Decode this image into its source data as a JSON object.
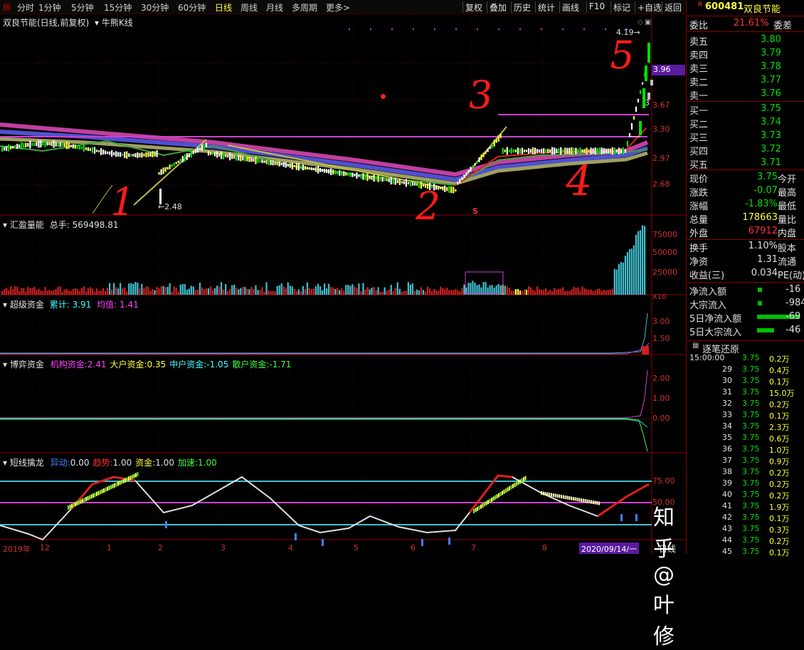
{
  "toolbar": {
    "periods": [
      "分时",
      "1分钟",
      "5分钟",
      "15分钟",
      "30分钟",
      "60分钟",
      "日线",
      "周线",
      "月线",
      "多周期",
      "更多>"
    ],
    "active_period": "日线",
    "right_buttons": [
      "复权",
      "叠加",
      "历史",
      "统计",
      "画线",
      "F10",
      "标记",
      "+自选",
      "返回"
    ]
  },
  "kline": {
    "title": "双良节能(日线,前复权)",
    "indicator": "牛熊K线",
    "price_labels": [
      "3.96",
      "3.67",
      "3.30",
      "2.97",
      "2.68"
    ],
    "low_label": "2.48",
    "high_label": "4.19",
    "small_label": "3",
    "marker_s": "S"
  },
  "volume": {
    "title": "汇盈量能",
    "total_label": "总手:",
    "total_value": "569498.81",
    "axis": [
      "75000",
      "50000",
      "25000"
    ],
    "unit": "X10"
  },
  "super_funds": {
    "title": "超级资金",
    "accum_label": "累计:",
    "accum_value": "3.91",
    "avg_label": "均值:",
    "avg_value": "1.41",
    "axis": [
      "3.00",
      "1.50"
    ]
  },
  "game_funds": {
    "title": "博弈资金",
    "items": [
      {
        "label": "机构资金:",
        "value": "2.41",
        "color": "#ff40ff"
      },
      {
        "label": "大户资金:",
        "value": "0.35",
        "color": "#ffff40"
      },
      {
        "label": "中户资金:",
        "value": "-1.05",
        "color": "#40ffff"
      },
      {
        "label": "散户资金:",
        "value": "-1.71",
        "color": "#40ff40"
      }
    ],
    "axis": [
      "2.00",
      "1.00",
      "0.00"
    ]
  },
  "short_line": {
    "title": "短线擒龙",
    "items": [
      {
        "label": "异动:",
        "value": "0.00",
        "color": "#4080ff"
      },
      {
        "label": "趋势:",
        "value": "1.00",
        "color": "#ff3030"
      },
      {
        "label": "资金:",
        "value": "1.00",
        "color": "#ffff40"
      },
      {
        "label": "加速:",
        "value": "1.00",
        "color": "#40ff40"
      }
    ],
    "axis": [
      "75.00",
      "50.00"
    ]
  },
  "xaxis": {
    "labels": [
      "2019年",
      "12",
      "1",
      "2",
      "3",
      "4",
      "5",
      "6",
      "7",
      "8"
    ],
    "date_badge": "2020/09/14/一",
    "period": "日线"
  },
  "annotations": [
    "1",
    "2",
    "3",
    "4",
    "5"
  ],
  "watermark": "知乎 @叶修",
  "quote": {
    "code": "600481",
    "name": "双良节能",
    "webi_label": "委比",
    "webi_value": "21.61%",
    "weicha_label": "委差",
    "sell": [
      {
        "label": "卖五",
        "price": "3.80"
      },
      {
        "label": "卖四",
        "price": "3.79"
      },
      {
        "label": "卖三",
        "price": "3.78"
      },
      {
        "label": "卖二",
        "price": "3.77"
      },
      {
        "label": "卖一",
        "price": "3.76"
      }
    ],
    "buy": [
      {
        "label": "买一",
        "price": "3.75"
      },
      {
        "label": "买二",
        "price": "3.74"
      },
      {
        "label": "买三",
        "price": "3.73"
      },
      {
        "label": "买四",
        "price": "3.72"
      },
      {
        "label": "买五",
        "price": "3.71"
      }
    ],
    "stats": [
      {
        "l": "现价",
        "v": "3.75",
        "r": "今开",
        "vc": "#00e000"
      },
      {
        "l": "涨跌",
        "v": "-0.07",
        "r": "最高",
        "vc": "#00e000"
      },
      {
        "l": "涨幅",
        "v": "-1.83%",
        "r": "最低",
        "vc": "#00e000"
      },
      {
        "l": "总量",
        "v": "178663",
        "r": "量比",
        "vc": "#ffff40"
      },
      {
        "l": "外盘",
        "v": "67912",
        "r": "内盘",
        "vc": "#ff3030"
      },
      {
        "l": "换手",
        "v": "1.10%",
        "r": "股本",
        "vc": "#e0e0e0"
      },
      {
        "l": "净资",
        "v": "1.31",
        "r": "流通",
        "vc": "#e0e0e0"
      },
      {
        "l": "收益(三)",
        "v": "0.034",
        "r": "PE(动)",
        "vc": "#e0e0e0"
      }
    ],
    "flows": [
      {
        "l": "净流入额",
        "v": "-16"
      },
      {
        "l": "大宗流入",
        "v": "-984"
      },
      {
        "l": "5日净流入额",
        "v": "-69"
      },
      {
        "l": "5日大宗流入",
        "v": "-46"
      }
    ],
    "ticks_title": "逐笔还原",
    "ticks": [
      [
        "15:00:00",
        "3.75",
        "0.2万"
      ],
      [
        "29",
        "3.75",
        "0.4万"
      ],
      [
        "30",
        "3.75",
        "0.1万"
      ],
      [
        "31",
        "3.75",
        "15.0万"
      ],
      [
        "32",
        "3.75",
        "0.2万"
      ],
      [
        "33",
        "3.75",
        "0.1万"
      ],
      [
        "34",
        "3.75",
        "2.3万"
      ],
      [
        "35",
        "3.75",
        "0.6万"
      ],
      [
        "36",
        "3.75",
        "1.0万"
      ],
      [
        "37",
        "3.75",
        "0.9万"
      ],
      [
        "38",
        "3.75",
        "0.2万"
      ],
      [
        "39",
        "3.75",
        "0.2万"
      ],
      [
        "40",
        "3.75",
        "0.2万"
      ],
      [
        "41",
        "3.75",
        "1.9万"
      ],
      [
        "42",
        "3.75",
        "0.1万"
      ],
      [
        "43",
        "3.75",
        "0.3万"
      ],
      [
        "44",
        "3.75",
        "0.2万"
      ],
      [
        "45",
        "3.75",
        "0.1万"
      ]
    ]
  },
  "chart_data": {
    "type": "candlestick",
    "x_labels": [
      "2019年",
      "12",
      "1",
      "2",
      "3",
      "4",
      "5",
      "6",
      "7",
      "8"
    ],
    "price_ticks": [
      3.96,
      3.67,
      3.3,
      2.97,
      2.68
    ],
    "low_annotated": 2.48,
    "high_annotated": 4.19
  }
}
